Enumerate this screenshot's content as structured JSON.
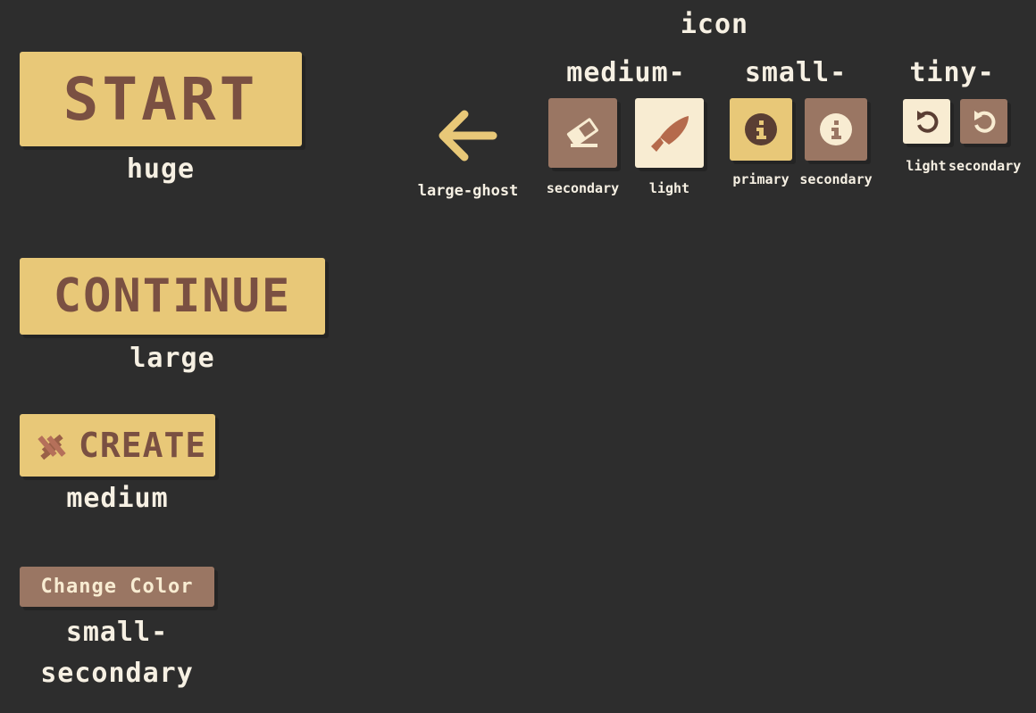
{
  "huge_button": {
    "label": "START",
    "caption": "huge"
  },
  "large_button": {
    "label": "CONTINUE",
    "caption": "large"
  },
  "medium_button": {
    "label": "CREATE",
    "icon": "hash-icon",
    "caption": "medium"
  },
  "small_secondary_button": {
    "label": "Change Color",
    "caption_line1": "small-",
    "caption_line2": "secondary"
  },
  "icon_section": {
    "title": "icon",
    "large_ghost": {
      "icon": "arrow-left-icon",
      "caption": "large-ghost"
    },
    "medium": {
      "heading": "medium-",
      "secondary": {
        "icon": "eraser-icon",
        "caption": "secondary"
      },
      "light": {
        "icon": "knife-icon",
        "caption": "light"
      }
    },
    "small": {
      "heading": "small-",
      "primary": {
        "icon": "info-icon",
        "caption": "primary"
      },
      "secondary": {
        "icon": "info-icon",
        "caption": "secondary"
      }
    },
    "tiny": {
      "heading": "tiny-",
      "light": {
        "icon": "undo-icon",
        "caption": "light"
      },
      "secondary": {
        "icon": "undo-icon",
        "caption": "secondary"
      }
    }
  },
  "colors": {
    "background": "#2d2d2d",
    "primary": "#e8c878",
    "primary_text": "#7a5042",
    "secondary": "#9a7663",
    "light": "#f8ecd2",
    "accent": "#b56a4c",
    "caption": "#f6f0e3"
  }
}
